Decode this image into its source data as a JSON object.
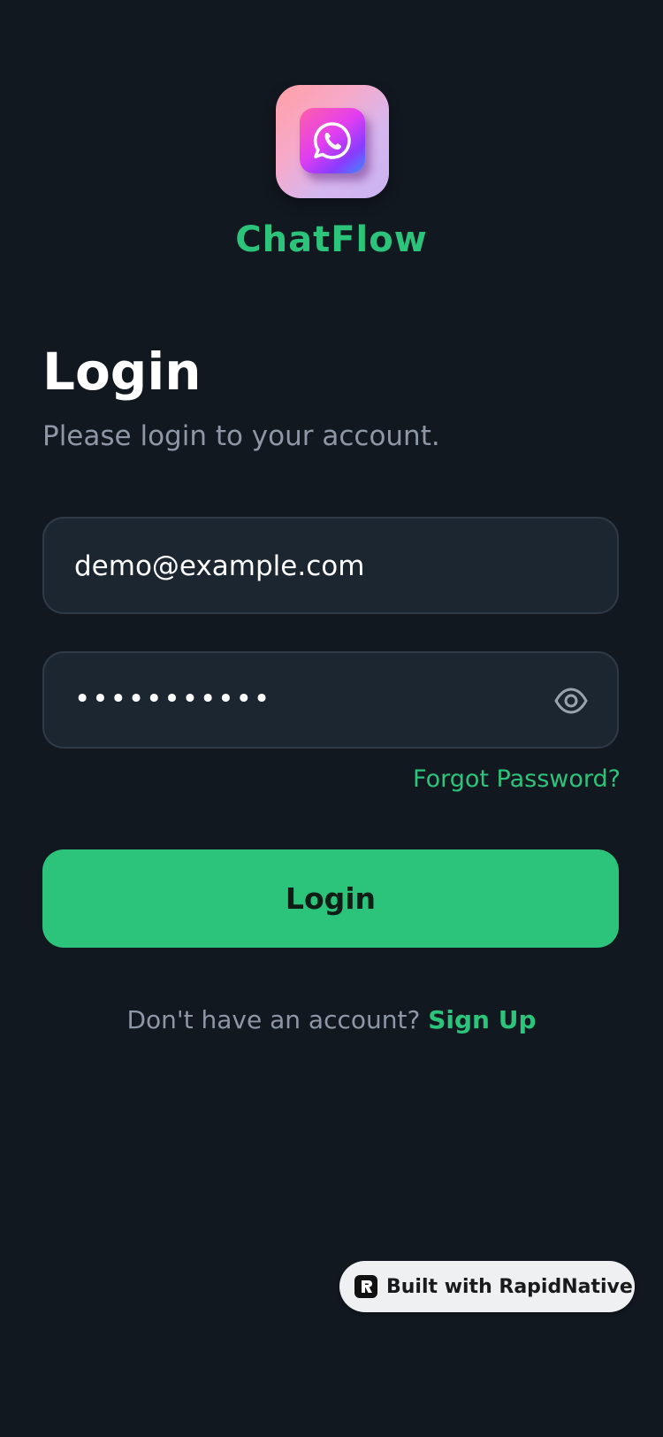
{
  "app": {
    "name": "ChatFlow",
    "logo_icon": "whatsapp-icon",
    "brand_color": "#2cc47b",
    "background_color": "#121820"
  },
  "login": {
    "title": "Login",
    "subtitle": "Please login to your account.",
    "email_value": "demo@example.com",
    "password_value": "•••••••••••",
    "password_toggle_icon": "eye-icon",
    "forgot_password": "Forgot Password?",
    "submit_label": "Login",
    "signup_prompt": "Don't have an account?",
    "signup_link": "Sign Up"
  },
  "badge": {
    "label": "Built with RapidNative",
    "icon": "rapidnative-logo-icon"
  }
}
